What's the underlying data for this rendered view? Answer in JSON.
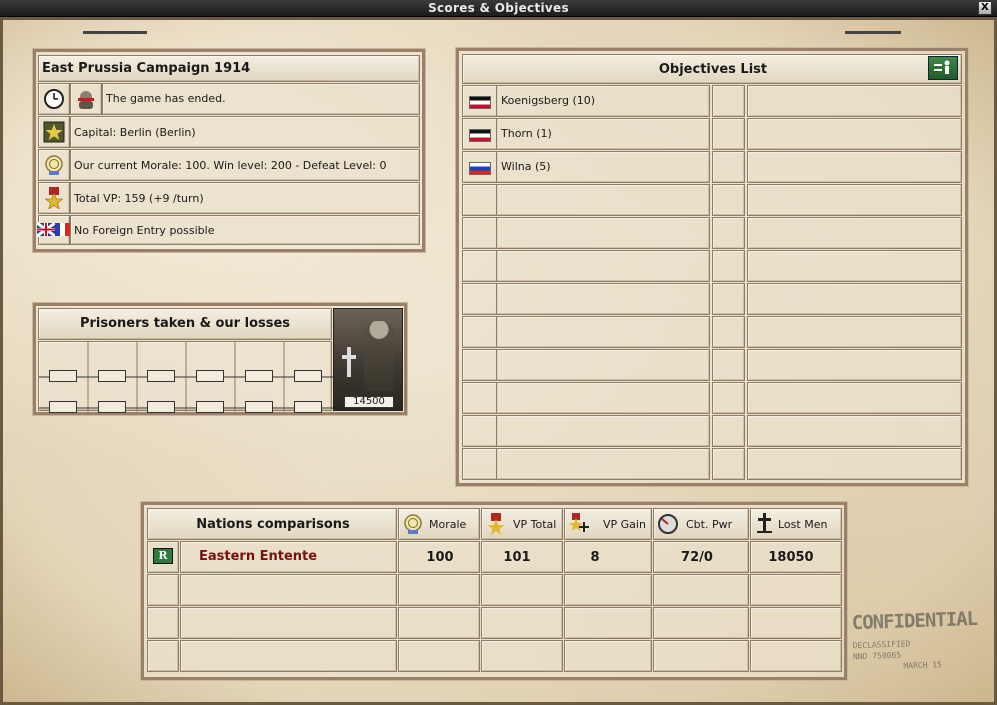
{
  "window": {
    "title": "Scores & Objectives",
    "close_label": "X"
  },
  "campaign": {
    "title": "East Prussia Campaign 1914",
    "status": "The game has ended.",
    "capital": "Capital: Berlin (Berlin)",
    "morale": "Our current Morale: 100. Win level: 200 - Defeat Level: 0",
    "vp": "Total VP: 159 (+9 /turn)",
    "foreign_entry": "No Foreign Entry possible"
  },
  "prisoners": {
    "title": "Prisoners taken & our losses",
    "photo_count": "14500"
  },
  "objectives": {
    "title": "Objectives List",
    "items": [
      {
        "name": "Koenigsberg (10)",
        "flag": "germany"
      },
      {
        "name": "Thorn (1)",
        "flag": "germany"
      },
      {
        "name": "Wilna (5)",
        "flag": "russia"
      }
    ]
  },
  "nations": {
    "title": "Nations comparisons",
    "columns": [
      "Morale",
      "VP Total",
      "VP Gain",
      "Cbt. Pwr",
      "Lost Men"
    ],
    "rows": [
      {
        "badge": "R",
        "name": "Eastern Entente",
        "morale": "100",
        "vp_total": "101",
        "vp_gain": "8",
        "cbt_pwr": "72/0",
        "lost_men": "18050"
      }
    ]
  },
  "stamp": {
    "word": "CONFIDENTIAL",
    "line1": "DECLASSIFIED",
    "line2": "NND 750065",
    "line3": "MARCH 15"
  },
  "colors": {
    "nation_name": "#7a1010",
    "accent_green": "#2e7a3c"
  }
}
